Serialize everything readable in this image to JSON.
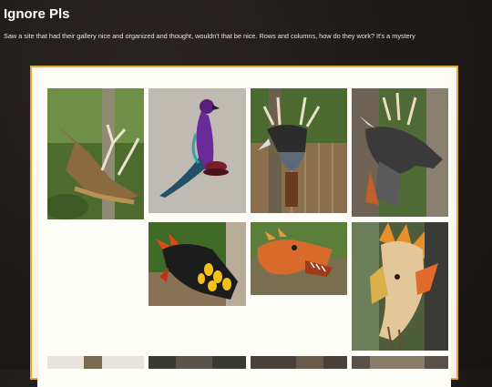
{
  "header": {
    "title": "Ignore Pls",
    "description": "Saw a site that had their gallery nice and organized and thought, wouldn't that be nice. Rows and columns, how do they work? It's a mystery"
  },
  "gallery": {
    "frame_color": "#e5a83a",
    "background_color": "#fffaf0",
    "photos": [
      {
        "name": "antlered-wall-dragon-1"
      },
      {
        "name": "purple-bird-sculpture"
      },
      {
        "name": "antlered-dragon-head-on-fence"
      },
      {
        "name": "antlered-dragon-head-on-tree"
      },
      {
        "name": "black-yellow-dragon-head"
      },
      {
        "name": "orange-dragon-head"
      },
      {
        "name": "orange-finned-dragon-head"
      },
      {
        "name": "partial-row-photo-1"
      },
      {
        "name": "partial-row-photo-2"
      },
      {
        "name": "partial-row-photo-3"
      },
      {
        "name": "partial-row-photo-4"
      }
    ]
  }
}
